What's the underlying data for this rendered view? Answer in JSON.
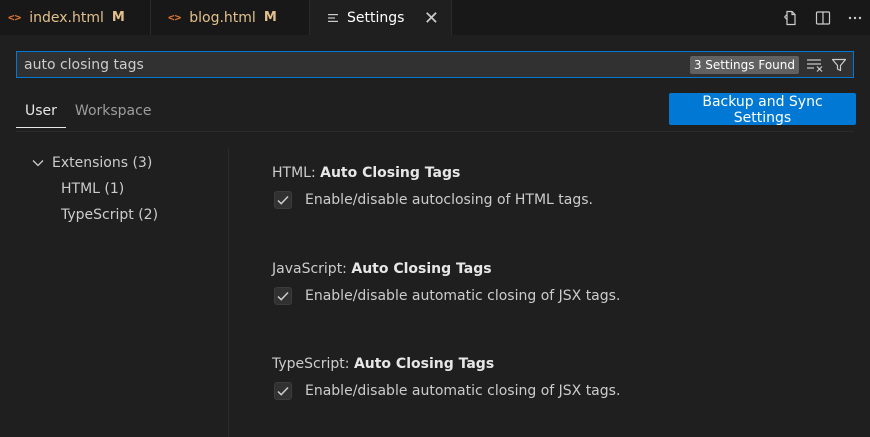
{
  "tabs": [
    {
      "label": "index.html",
      "status": "M"
    },
    {
      "label": "blog.html",
      "status": "M"
    },
    {
      "label": "Settings",
      "close": "✕"
    }
  ],
  "tabbar_actions": [
    "open-settings-json-icon",
    "split-editor-icon",
    "more-actions-icon"
  ],
  "search": {
    "value": "auto closing tags",
    "results_badge": "3 Settings Found"
  },
  "scope_tabs": {
    "user": "User",
    "workspace": "Workspace"
  },
  "sync_button": "Backup and Sync Settings",
  "toc": {
    "extensions": "Extensions (3)",
    "html": "HTML (1)",
    "typescript": "TypeScript (2)"
  },
  "settings": [
    {
      "category": "HTML: ",
      "name": "Auto Closing Tags",
      "description": "Enable/disable autoclosing of HTML tags.",
      "checked": true
    },
    {
      "category": "JavaScript: ",
      "name": "Auto Closing Tags",
      "description": "Enable/disable automatic closing of JSX tags.",
      "checked": true
    },
    {
      "category": "TypeScript: ",
      "name": "Auto Closing Tags",
      "description": "Enable/disable automatic closing of JSX tags.",
      "checked": true
    }
  ],
  "colors": {
    "accent": "#0078d4",
    "modified": "#e2c08d",
    "html_icon": "#e37933"
  }
}
